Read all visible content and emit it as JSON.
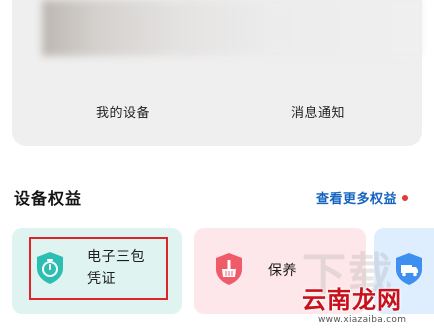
{
  "device_card": {
    "my_devices_label": "我的设备",
    "messages_label": "消息通知"
  },
  "benefits": {
    "title": "设备权益",
    "more_label": "查看更多权益",
    "items": [
      {
        "label_line1": "电子三包",
        "label_line2": "凭证",
        "icon": "shield-timer-icon",
        "color": "#2bbfb3"
      },
      {
        "label_line1": "保养",
        "label_line2": "",
        "icon": "shield-broom-icon",
        "color": "#ef5b68"
      },
      {
        "label_line1": "",
        "label_line2": "",
        "icon": "shield-truck-icon",
        "color": "#3d8ff0"
      }
    ],
    "badge_color": "#e53935"
  },
  "watermark": {
    "brand": "云南龙网",
    "url": "www.xiazaiba.com"
  }
}
